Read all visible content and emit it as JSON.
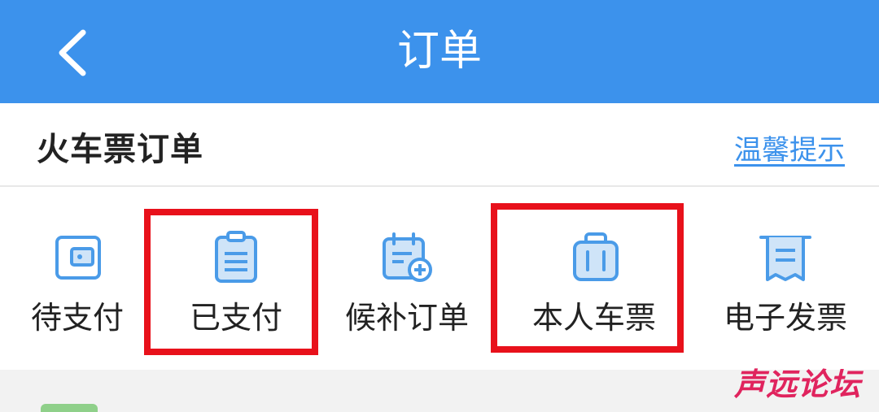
{
  "navbar": {
    "title": "订单",
    "back_icon": "chevron-left-icon"
  },
  "section": {
    "title": "火车票订单",
    "tips_link": "温馨提示"
  },
  "menu": {
    "items": [
      {
        "label": "待支付",
        "icon": "wallet-icon"
      },
      {
        "label": "已支付",
        "icon": "clipboard-icon"
      },
      {
        "label": "候补订单",
        "icon": "calendar-add-icon"
      },
      {
        "label": "本人车票",
        "icon": "luggage-icon"
      },
      {
        "label": "电子发票",
        "icon": "receipt-icon"
      }
    ]
  },
  "highlight_color": "#e8111b",
  "accent_color": "#3c92ec",
  "watermark": "声远论坛"
}
